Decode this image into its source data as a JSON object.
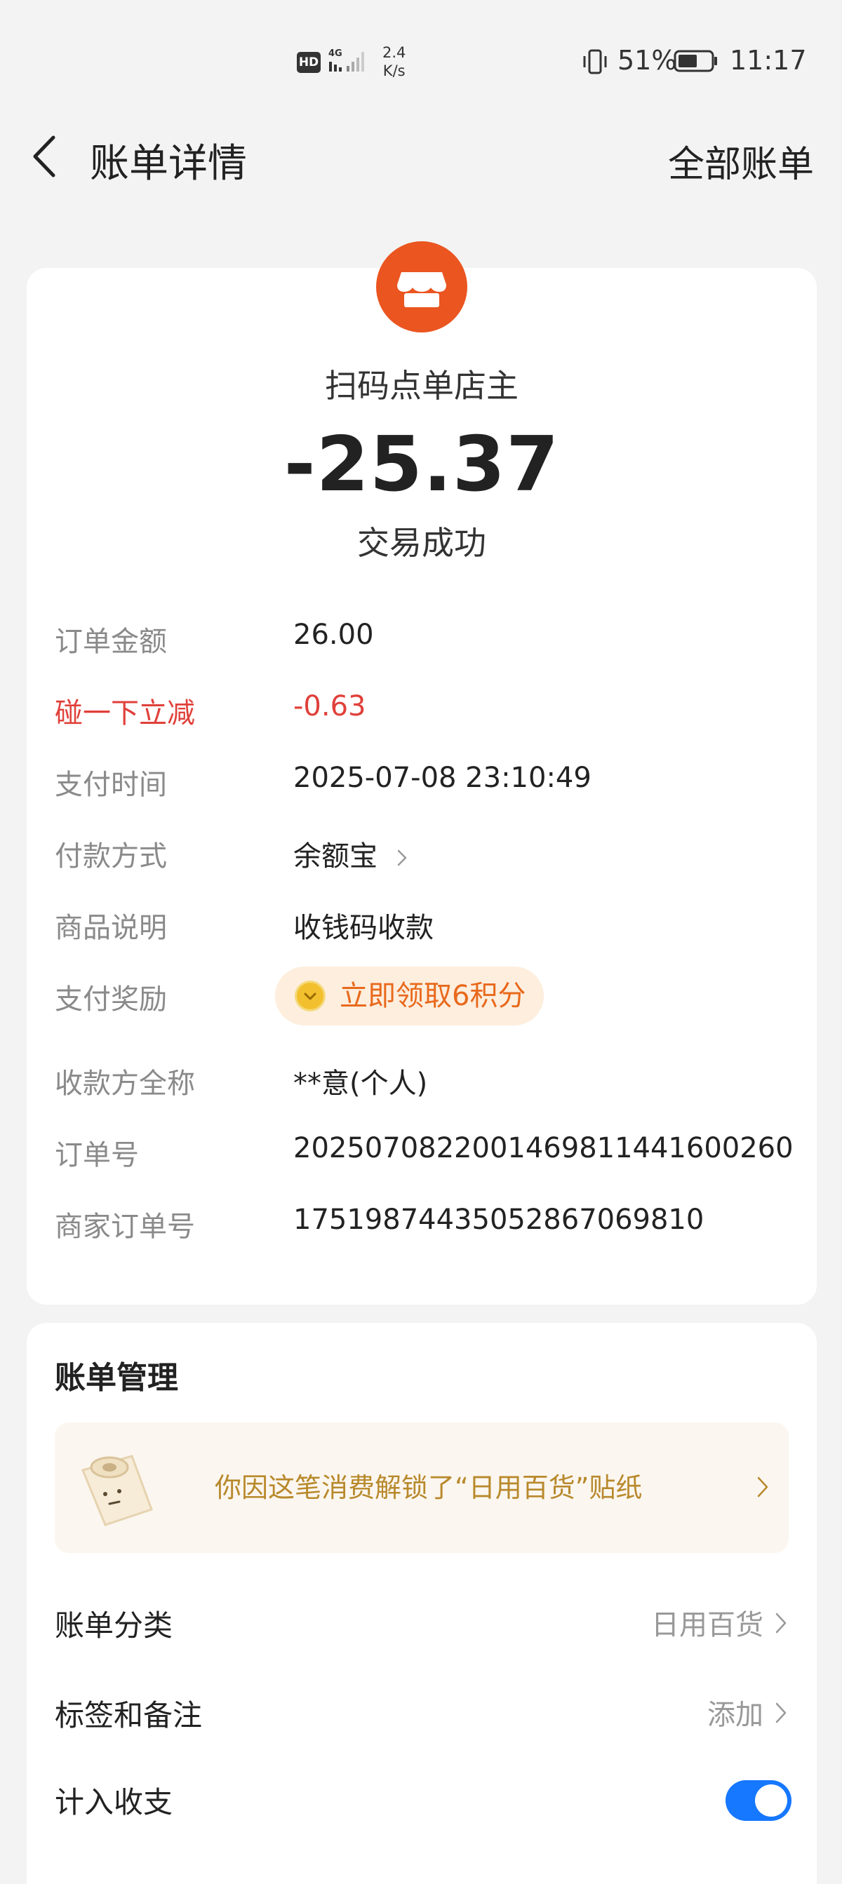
{
  "status_bar": {
    "hd": "HD",
    "network": "4G",
    "speed_value": "2.4",
    "speed_unit": "K/s",
    "battery": "51%",
    "time": "11:17"
  },
  "header": {
    "title": "账单详情",
    "all_bills": "全部账单"
  },
  "summary": {
    "merchant": "扫码点单店主",
    "amount": "-25.37",
    "status": "交易成功",
    "merchant_icon_color": "#ea5520"
  },
  "details": {
    "order_amount": {
      "label": "订单金额",
      "value": "26.00"
    },
    "discount": {
      "label": "碰一下立减",
      "value": "-0.63"
    },
    "pay_time": {
      "label": "支付时间",
      "value": "2025-07-08 23:10:49"
    },
    "pay_method": {
      "label": "付款方式",
      "value": "余额宝"
    },
    "product_desc": {
      "label": "商品说明",
      "value": "收钱码收款"
    },
    "reward": {
      "label": "支付奖励",
      "value": "立即领取6积分"
    },
    "payee_name": {
      "label": "收款方全称",
      "value": "**意(个人)"
    },
    "order_no": {
      "label": "订单号",
      "value": "2025070822001469811441600260"
    },
    "merchant_order_no": {
      "label": "商家订单号",
      "value": "17519874435052867069810"
    }
  },
  "management": {
    "title": "账单管理",
    "sticker_text": "你因这笔消费解锁了“日用百货”贴纸",
    "category": {
      "label": "账单分类",
      "value": "日用百货"
    },
    "tags": {
      "label": "标签和备注",
      "value": "添加"
    },
    "include": {
      "label": "计入收支",
      "enabled": true
    }
  },
  "colors": {
    "accent_blue": "#1677ff",
    "discount_red": "#e0403a",
    "reward_orange": "#e8691c",
    "sticker_gold": "#b8892c"
  }
}
